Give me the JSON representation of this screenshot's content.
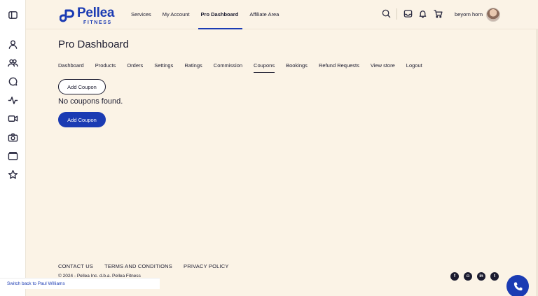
{
  "header": {
    "logo_title": "Pellea",
    "logo_sub": "FITNESS",
    "nav": [
      "Services",
      "My Account",
      "Pro Dashboard",
      "Affiliate Area"
    ],
    "active_nav": "Pro Dashboard",
    "username": "beyorn horn"
  },
  "sidebar": {
    "icons": [
      "sidebar-toggle-icon",
      "user-icon",
      "users-icon",
      "chat-icon",
      "activity-icon",
      "video-icon",
      "camera-icon",
      "wallet-icon",
      "star-icon"
    ]
  },
  "main": {
    "title": "Pro Dashboard",
    "tabs": [
      "Dashboard",
      "Products",
      "Orders",
      "Settings",
      "Ratings",
      "Commission",
      "Coupons",
      "Bookings",
      "Refund Requests",
      "View store",
      "Logout"
    ],
    "active_tab": "Coupons",
    "add_coupon_top": "Add Coupon",
    "empty_message": "No coupons found.",
    "add_coupon_bottom": "Add Coupon"
  },
  "footer": {
    "links": [
      "CONTACT US",
      "TERMS AND CONDITIONS",
      "PRIVACY POLICY"
    ],
    "copyright": "© 2024 - Pellea Inc. d.b.a. Pellea Fitness",
    "socials": [
      "facebook-icon",
      "instagram-icon",
      "linkedin-icon",
      "twitter-icon"
    ]
  },
  "switch_back": "Switch back to Paul Williams",
  "colors": {
    "brand": "#1b3bb3",
    "background": "#fbf3e6",
    "text": "#1b1b2f"
  }
}
